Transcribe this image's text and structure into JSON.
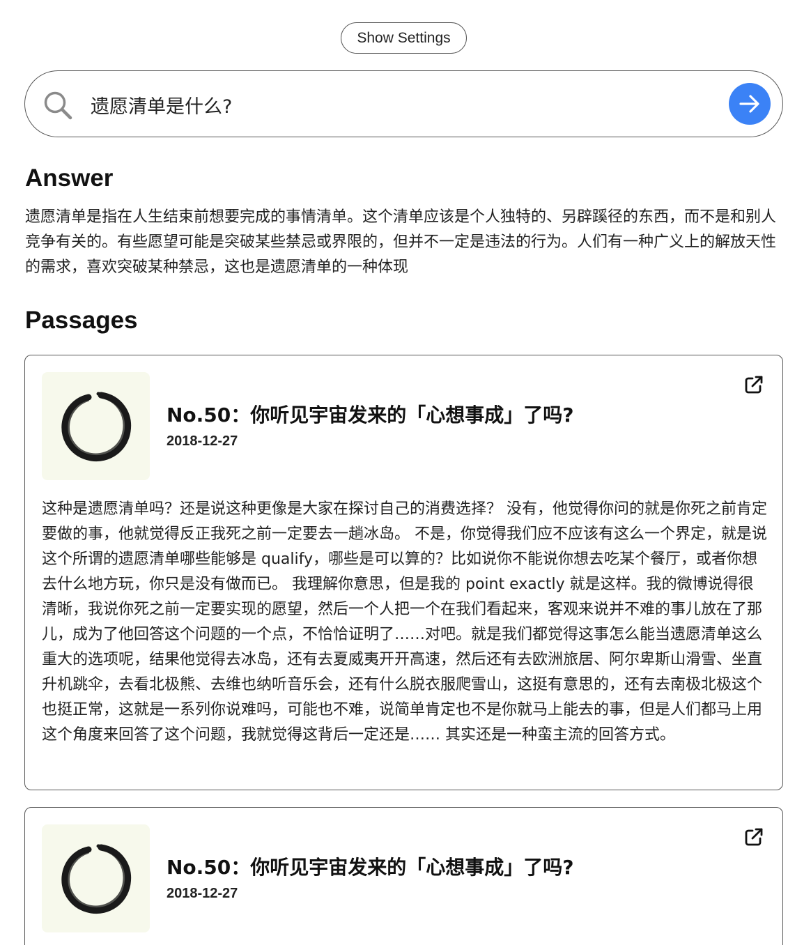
{
  "settings": {
    "show_label": "Show Settings"
  },
  "search": {
    "query": "遗愿清单是什么?",
    "icon": "search-icon",
    "submit_icon": "arrow-right-icon",
    "accent_color": "#3b82f6"
  },
  "answer": {
    "heading": "Answer",
    "text": "遗愿清单是指在人生结束前想要完成的事情清单。这个清单应该是个人独特的、另辟蹊径的东西，而不是和别人竞争有关的。有些愿望可能是突破某些禁忌或界限的，但并不一定是违法的行为。人们有一种广义上的解放天性的需求，喜欢突破某种禁忌，这也是遗愿清单的一种体现"
  },
  "passages": {
    "heading": "Passages",
    "items": [
      {
        "title": "No.50：你听见宇宙发来的「心想事成」了吗?",
        "date": "2018-12-27",
        "thumbnail": "enso-circle-logo",
        "link_icon": "external-link-icon",
        "text": "这种是遗愿清单吗？还是说这种更像是大家在探讨自己的消费选择？ 没有，他觉得你问的就是你死之前肯定要做的事，他就觉得反正我死之前一定要去一趟冰岛。 不是，你觉得我们应不应该有这么一个界定，就是说这个所谓的遗愿清单哪些能够是 qualify，哪些是可以算的？比如说你不能说你想去吃某个餐厅，或者你想去什么地方玩，你只是没有做而已。 我理解你意思，但是我的 point exactly 就是这样。我的微博说得很清晰，我说你死之前一定要实现的愿望，然后一个人把一个在我们看起来，客观来说并不难的事儿放在了那儿，成为了他回答这个问题的一个点，不恰恰证明了……对吧。就是我们都觉得这事怎么能当遗愿清单这么重大的选项呢，结果他觉得去冰岛，还有去夏威夷开开高速，然后还有去欧洲旅居、阿尔卑斯山滑雪、坐直升机跳伞，去看北极熊、去维也纳听音乐会，还有什么脱衣服爬雪山，这挺有意思的，还有去南极北极这个也挺正常，这就是一系列你说难吗，可能也不难，说简单肯定也不是你就马上能去的事，但是人们都马上用这个角度来回答了这个问题，我就觉得这背后一定还是…… 其实还是一种蛮主流的回答方式。"
      },
      {
        "title": "No.50：你听见宇宙发来的「心想事成」了吗?",
        "date": "2018-12-27",
        "thumbnail": "enso-circle-logo",
        "link_icon": "external-link-icon"
      }
    ]
  }
}
